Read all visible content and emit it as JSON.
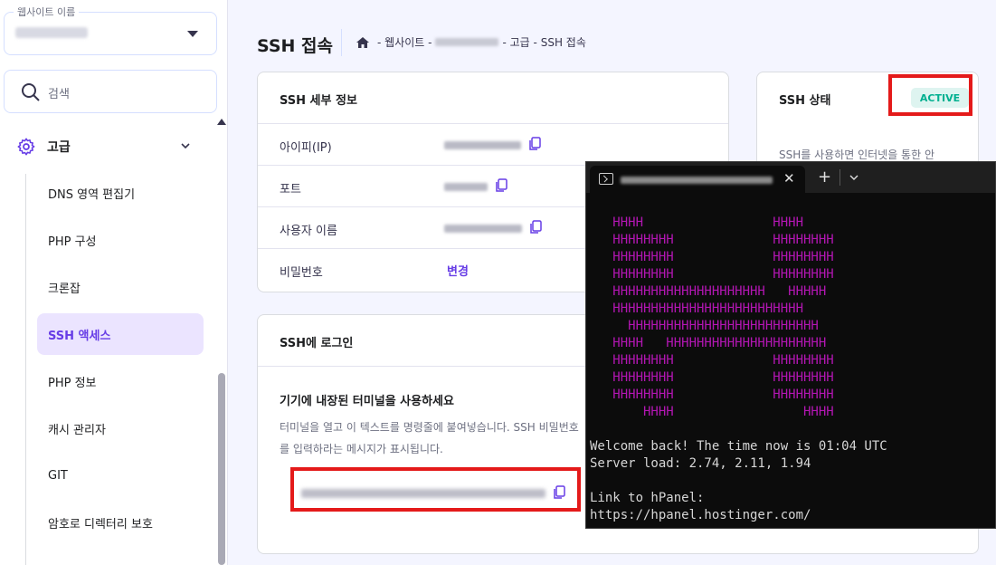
{
  "sidebar": {
    "site_select_label": "웹사이트 이름",
    "search_label": "검색",
    "group_label": "고급",
    "items": [
      {
        "label": "DNS 영역 편집기"
      },
      {
        "label": "PHP 구성"
      },
      {
        "label": "크론잡"
      },
      {
        "label": "SSH 액세스",
        "active": true
      },
      {
        "label": "PHP 정보"
      },
      {
        "label": "캐시 관리자"
      },
      {
        "label": "GIT"
      },
      {
        "label": "암호로 디렉터리 보호"
      }
    ]
  },
  "header": {
    "title": "SSH 접속",
    "breadcrumb": [
      "웹사이트",
      "고급",
      "SSH 접속"
    ]
  },
  "ssh_details": {
    "title": "SSH 세부 정보",
    "rows": [
      {
        "label": "아이피(IP)"
      },
      {
        "label": "포트"
      },
      {
        "label": "사용자 이름"
      },
      {
        "label": "비밀번호",
        "action": "변경"
      }
    ]
  },
  "ssh_status": {
    "title": "SSH 상태",
    "badge": "ACTIVE",
    "description": "SSH를 사용하면 인터넷을 통한 안"
  },
  "ssh_login": {
    "title": "SSH에 로그인",
    "subtitle": "기기에 내장된 터미널을 사용하세요",
    "description": "터미널을 열고 이 텍스트를 명령줄에 붙여넣습니다. SSH 비밀번호를 입력하라는 메시지가 표시됩니다."
  },
  "terminal": {
    "art": "   HHHH                 HHHH\n   HHHHHHHH             HHHHHHHH\n   HHHHHHHH             HHHHHHHH\n   HHHHHHHH             HHHHHHHH\n   HHHHHHHHHHHHHHHHHHHH   HHHHH\n   HHHHHHHHHHHHHHHHHHHHHHHHH\n     HHHHHHHHHHHHHHHHHHHHHHHHH\n   HHHH   HHHHHHHHHHHHHHHHHHHHH\n   HHHHHHHH             HHHHHHHH\n   HHHHHHHH             HHHHHHHH\n   HHHHHHHH             HHHHHHHH\n       HHHH                 HHHH",
    "welcome": "Welcome back! The time now is 01:04 UTC",
    "load": "Server load: 2.74, 2.11, 1.94",
    "link_label": "Link to hPanel:",
    "link_url": "https://hpanel.hostinger.com/"
  }
}
